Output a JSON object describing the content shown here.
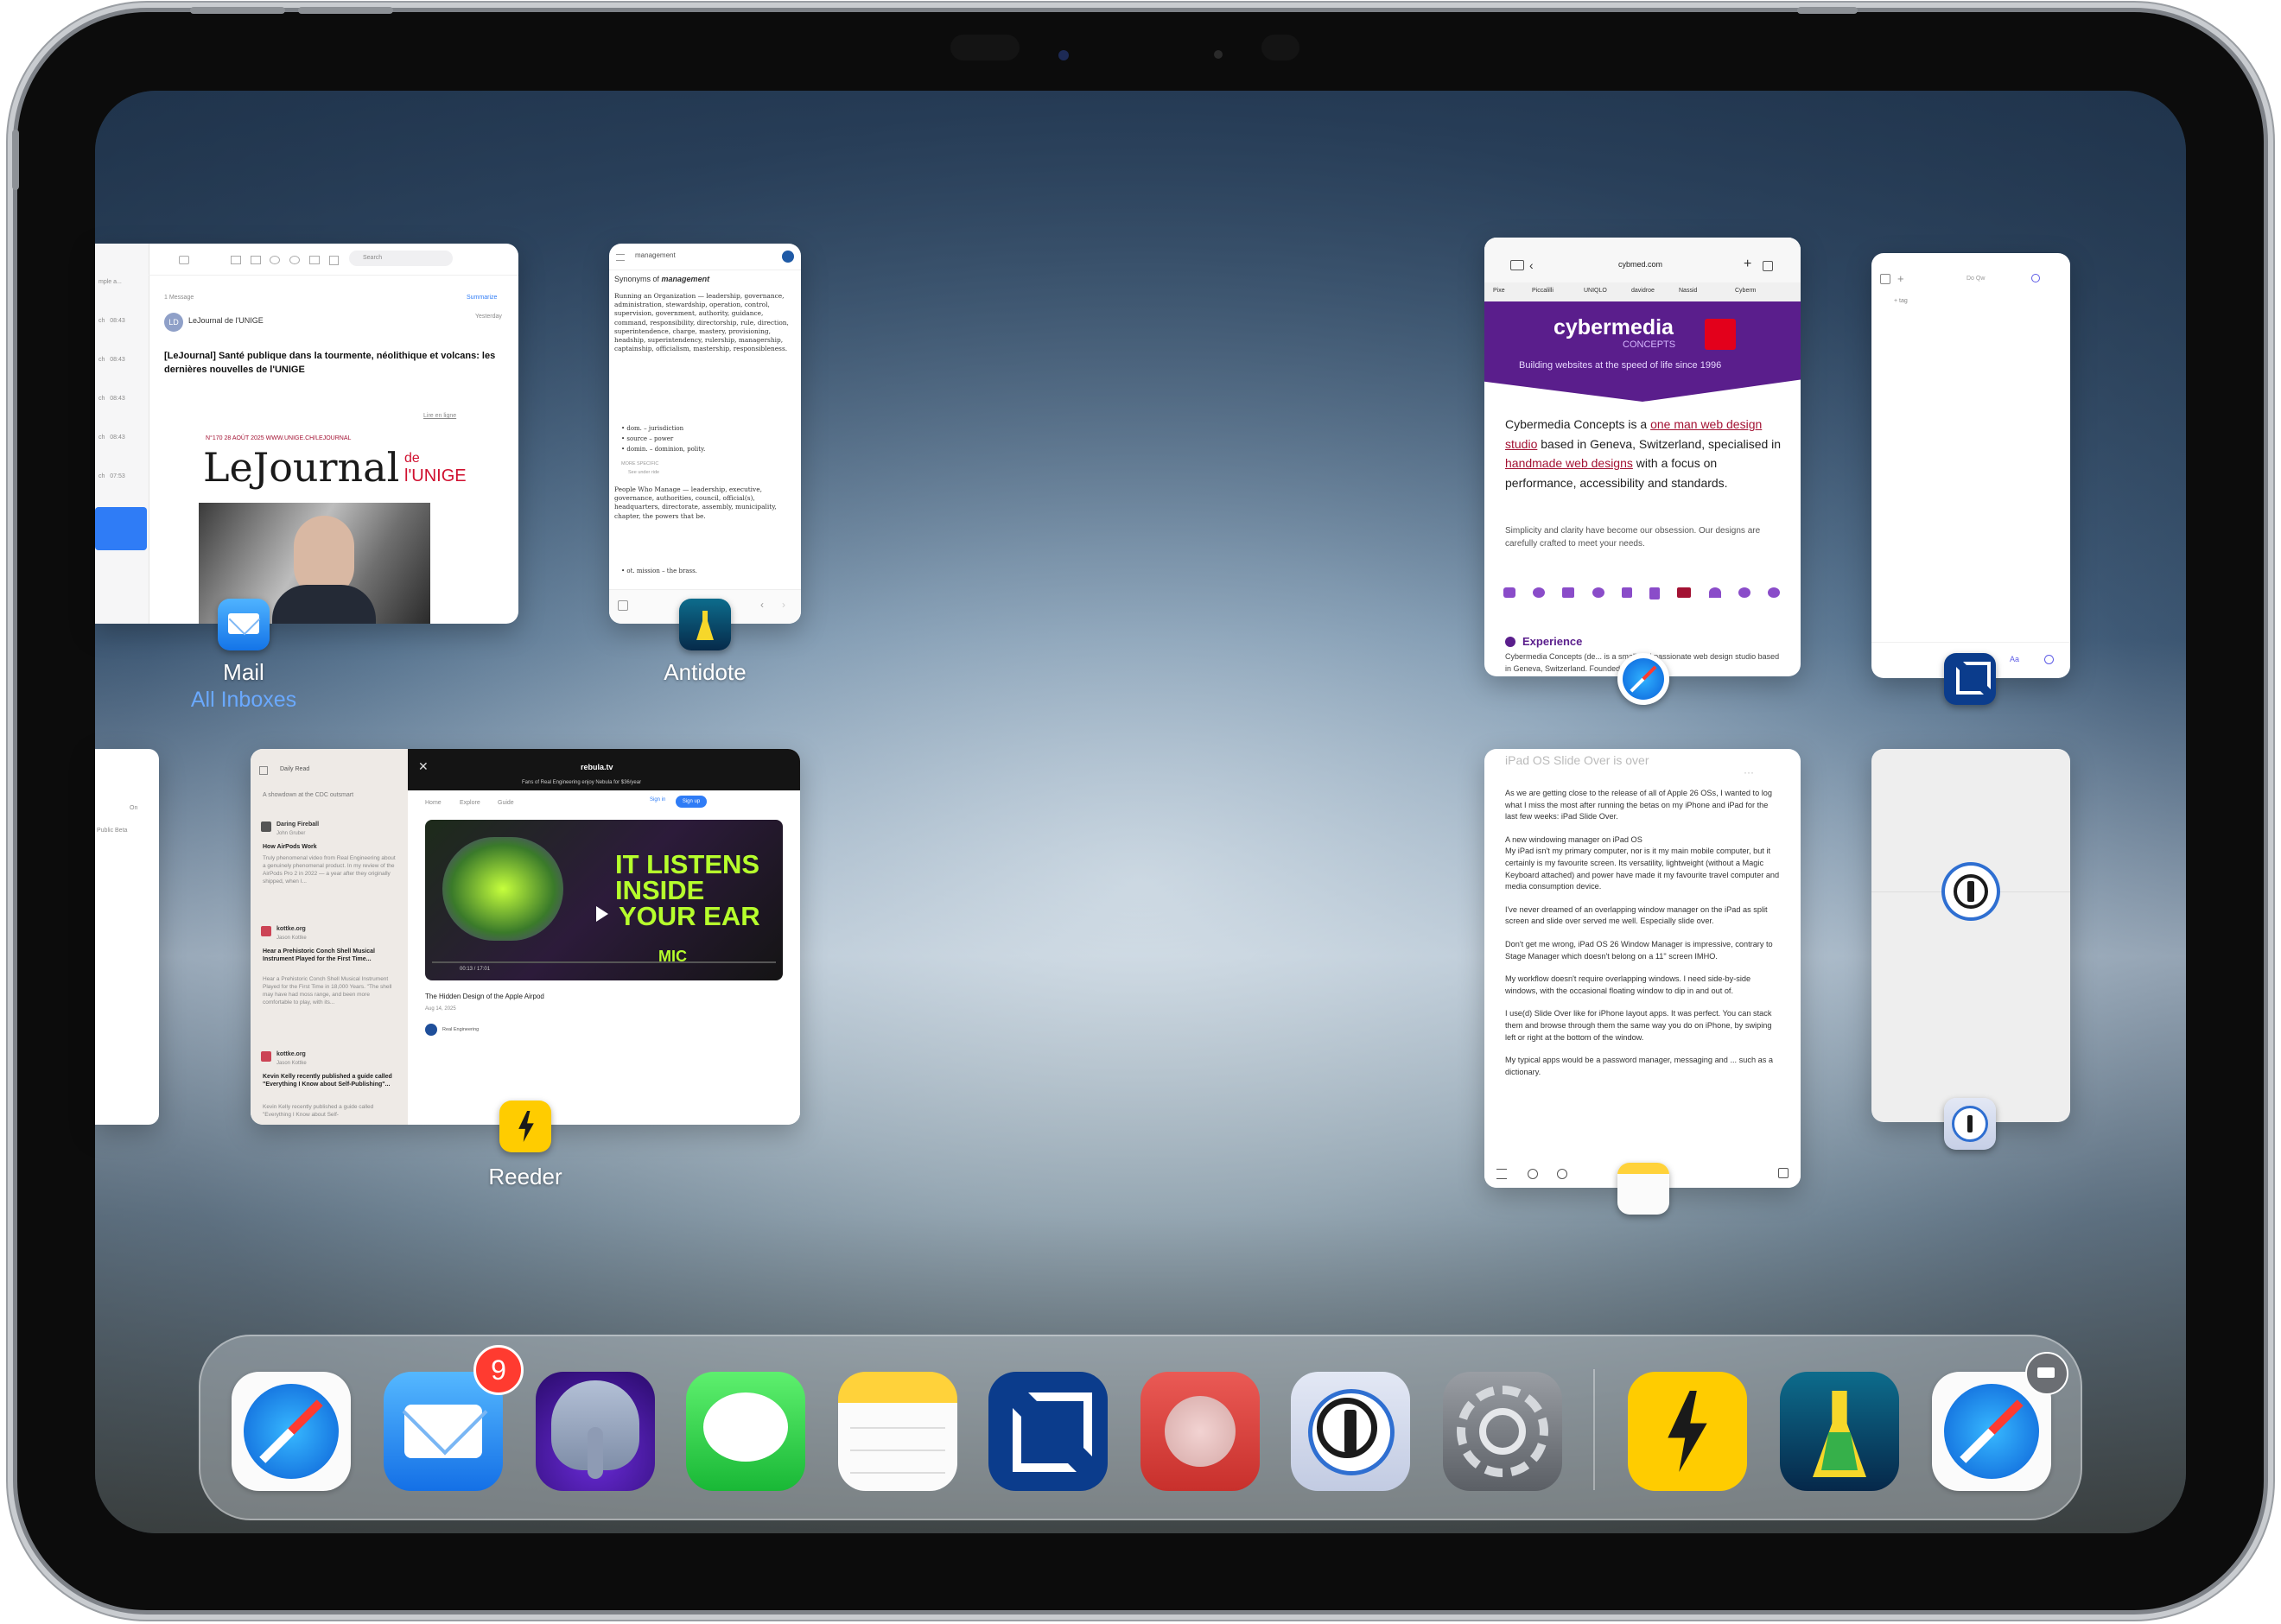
{
  "apps": {
    "mail": {
      "label": "Mail",
      "sublabel": "All Inboxes",
      "search_placeholder": "Search",
      "message_count": "1 Message",
      "sender": "LeJournal de l'UNIGE",
      "sender_initials": "LD",
      "date": "Yesterday",
      "subject": "[LeJournal] Santé publique dans la tourmente, néolithique et volcans: les dernières nouvelles de l'UNIGE",
      "issue": "N°170  28 AOÛT 2025  WWW.UNIGE.CH/LEJOURNAL",
      "masthead": "LeJournal",
      "masthead_suffix_1": "de",
      "masthead_suffix_2": "l'UNIGE",
      "summary": "Summarize",
      "read_online": "Lire en ligne"
    },
    "antidote": {
      "label": "Antidote",
      "search_value": "management",
      "heading_prefix": "Synonyms of",
      "heading_word": "management",
      "section_1": "Running an Organization — leadership, governance, administration, stewardship, operation, control, supervision, government, authority, guidance, command, responsibility, directorship, rule, direction, superintendence, charge, mastery, provisioning, headship, superintendency, rulership, managership, captainship, officialism, mastership, responsibleness.",
      "item_1": "• dom. – jurisdiction",
      "item_2": "• source – power",
      "item_3": "• domin. – dominion, polity.",
      "more_specific": "MORE SPECIFIC",
      "see_under": "See under ride",
      "section_2": "People Who Manage — leadership, executive, governance, authorities, council, official(s), headquarters, directorate, assembly, municipality, chapter, the powers that be.",
      "item_4": "• ot. mission – the brass."
    },
    "safari": {
      "url": "cybmed.com",
      "bookmarks": [
        "Pixe",
        "Piccalilli",
        "UNIQLO",
        "davidroe",
        "Nassid",
        "Cyberm"
      ],
      "brand": "cybermedia",
      "brand_sub": "CONCEPTS",
      "tagline": "Building websites at the speed of life since 1996",
      "intro_1": "Cybermedia Concepts is a ",
      "intro_link_1": "one man web design studio",
      "intro_2": " based in Geneva, Switzerland, specialised in ",
      "intro_link_2": "handmade web designs",
      "intro_3": " with a focus on performance, accessibility and standards.",
      "para": "Simplicity and clarity have become our obsession. Our designs are carefully crafted to meet your needs.",
      "experience": "Experience",
      "experience_text": "Cybermedia Concepts (de... is a small and passionate web design studio based in Geneva, Switzerland. Founded"
    },
    "notes_side": {
      "toolbar": "Do Qw",
      "tag": "+ tag"
    },
    "reeder": {
      "label": "Reeder",
      "list_title": "Daily Read",
      "list_sub": "A showdown at the CDC outsmart",
      "items": [
        {
          "source": "Daring Fireball",
          "author": "John Gruber",
          "title": "How AirPods Work",
          "text": "Truly phenomenal video from Real Engineering about a genuinely phenomenal product. In my review of the AirPods Pro 2 in 2022 — a year after they originally shipped, when I..."
        },
        {
          "source": "kottke.org",
          "author": "Jason Kottke",
          "title": "Hear a Prehistoric Conch Shell Musical Instrument Played for the First Time...",
          "text": "Hear a Prehistoric Conch Shell Musical Instrument Played for the First Time in 18,000 Years. \"The shell may have had moss range, and been more comfortable to play, with its..."
        },
        {
          "source": "kottke.org",
          "author": "Jason Kottke",
          "title": "Kevin Kelly recently published a guide called \"Everything I Know about Self-Publishing\"...",
          "text": "Kevin Kelly recently published a guide called \"Everything I Know about Self-"
        }
      ],
      "site": "rebula.tv",
      "banner": "Fans of Real Engineering enjoy Nebula for $36/year",
      "nav": [
        "Home",
        "Explore",
        "Guide"
      ],
      "sign_in": "Sign in",
      "sign_up": "Sign up",
      "video_title_1": "IT LISTENS",
      "video_title_2": "INSIDE",
      "video_title_3": "YOUR EAR",
      "mic": "MIC",
      "timecode": "00:13 / 17:01",
      "article_title": "The Hidden Design of the Apple Airpod",
      "article_date": "Aug 14, 2025",
      "channel": "Real Engineering"
    },
    "notes": {
      "title": "iPad OS Slide Over is over",
      "paragraphs": [
        "As we are getting close to the release of all of Apple 26 OSs, I wanted to log what I miss the most after running the betas on my iPhone and iPad for the last few weeks: iPad Slide Over.",
        "A new windowing manager on iPad OS\nMy iPad isn't my primary computer, nor is it my main mobile computer, but it certainly is my favourite screen. Its versatility, lightweight (without a Magic Keyboard attached) and power have made it my favourite travel computer and media consumption device.",
        "I've never dreamed of an overlapping window manager on the iPad as split screen and slide over served me well. Especially slide over.",
        "Don't get me wrong, iPad OS 26 Window Manager is impressive, contrary to Stage Manager which doesn't belong on a 11\" screen IMHO.",
        "My workflow doesn't require overlapping windows. I need side-by-side windows, with the occasional floating window to dip in and out of.",
        "I use(d) Slide Over like for iPhone layout apps. It was perfect. You can stack them and browse through them the same way you do on iPhone, by swiping left or right at the bottom of the window.",
        "My typical apps would be a password manager, messaging and ... such as a dictionary."
      ]
    },
    "side_left": {
      "text_1": "On",
      "text_2": "Public Beta"
    }
  },
  "dock": {
    "badge_mail": "9",
    "icons": [
      "safari-icon",
      "mail-icon",
      "tableplus-icon",
      "messages-icon",
      "notes-icon",
      "scrivener-icon",
      "record-icon",
      "onepassword-icon",
      "settings-icon",
      "reeder-icon",
      "antidote-icon",
      "safari-icon"
    ]
  },
  "colors": {
    "accent": "#0a84ff",
    "cybermedia_purple": "#5a1e8c",
    "link_red": "#a31233",
    "reeder_yellow": "#ffcc00",
    "badge_red": "#ff3b30"
  }
}
